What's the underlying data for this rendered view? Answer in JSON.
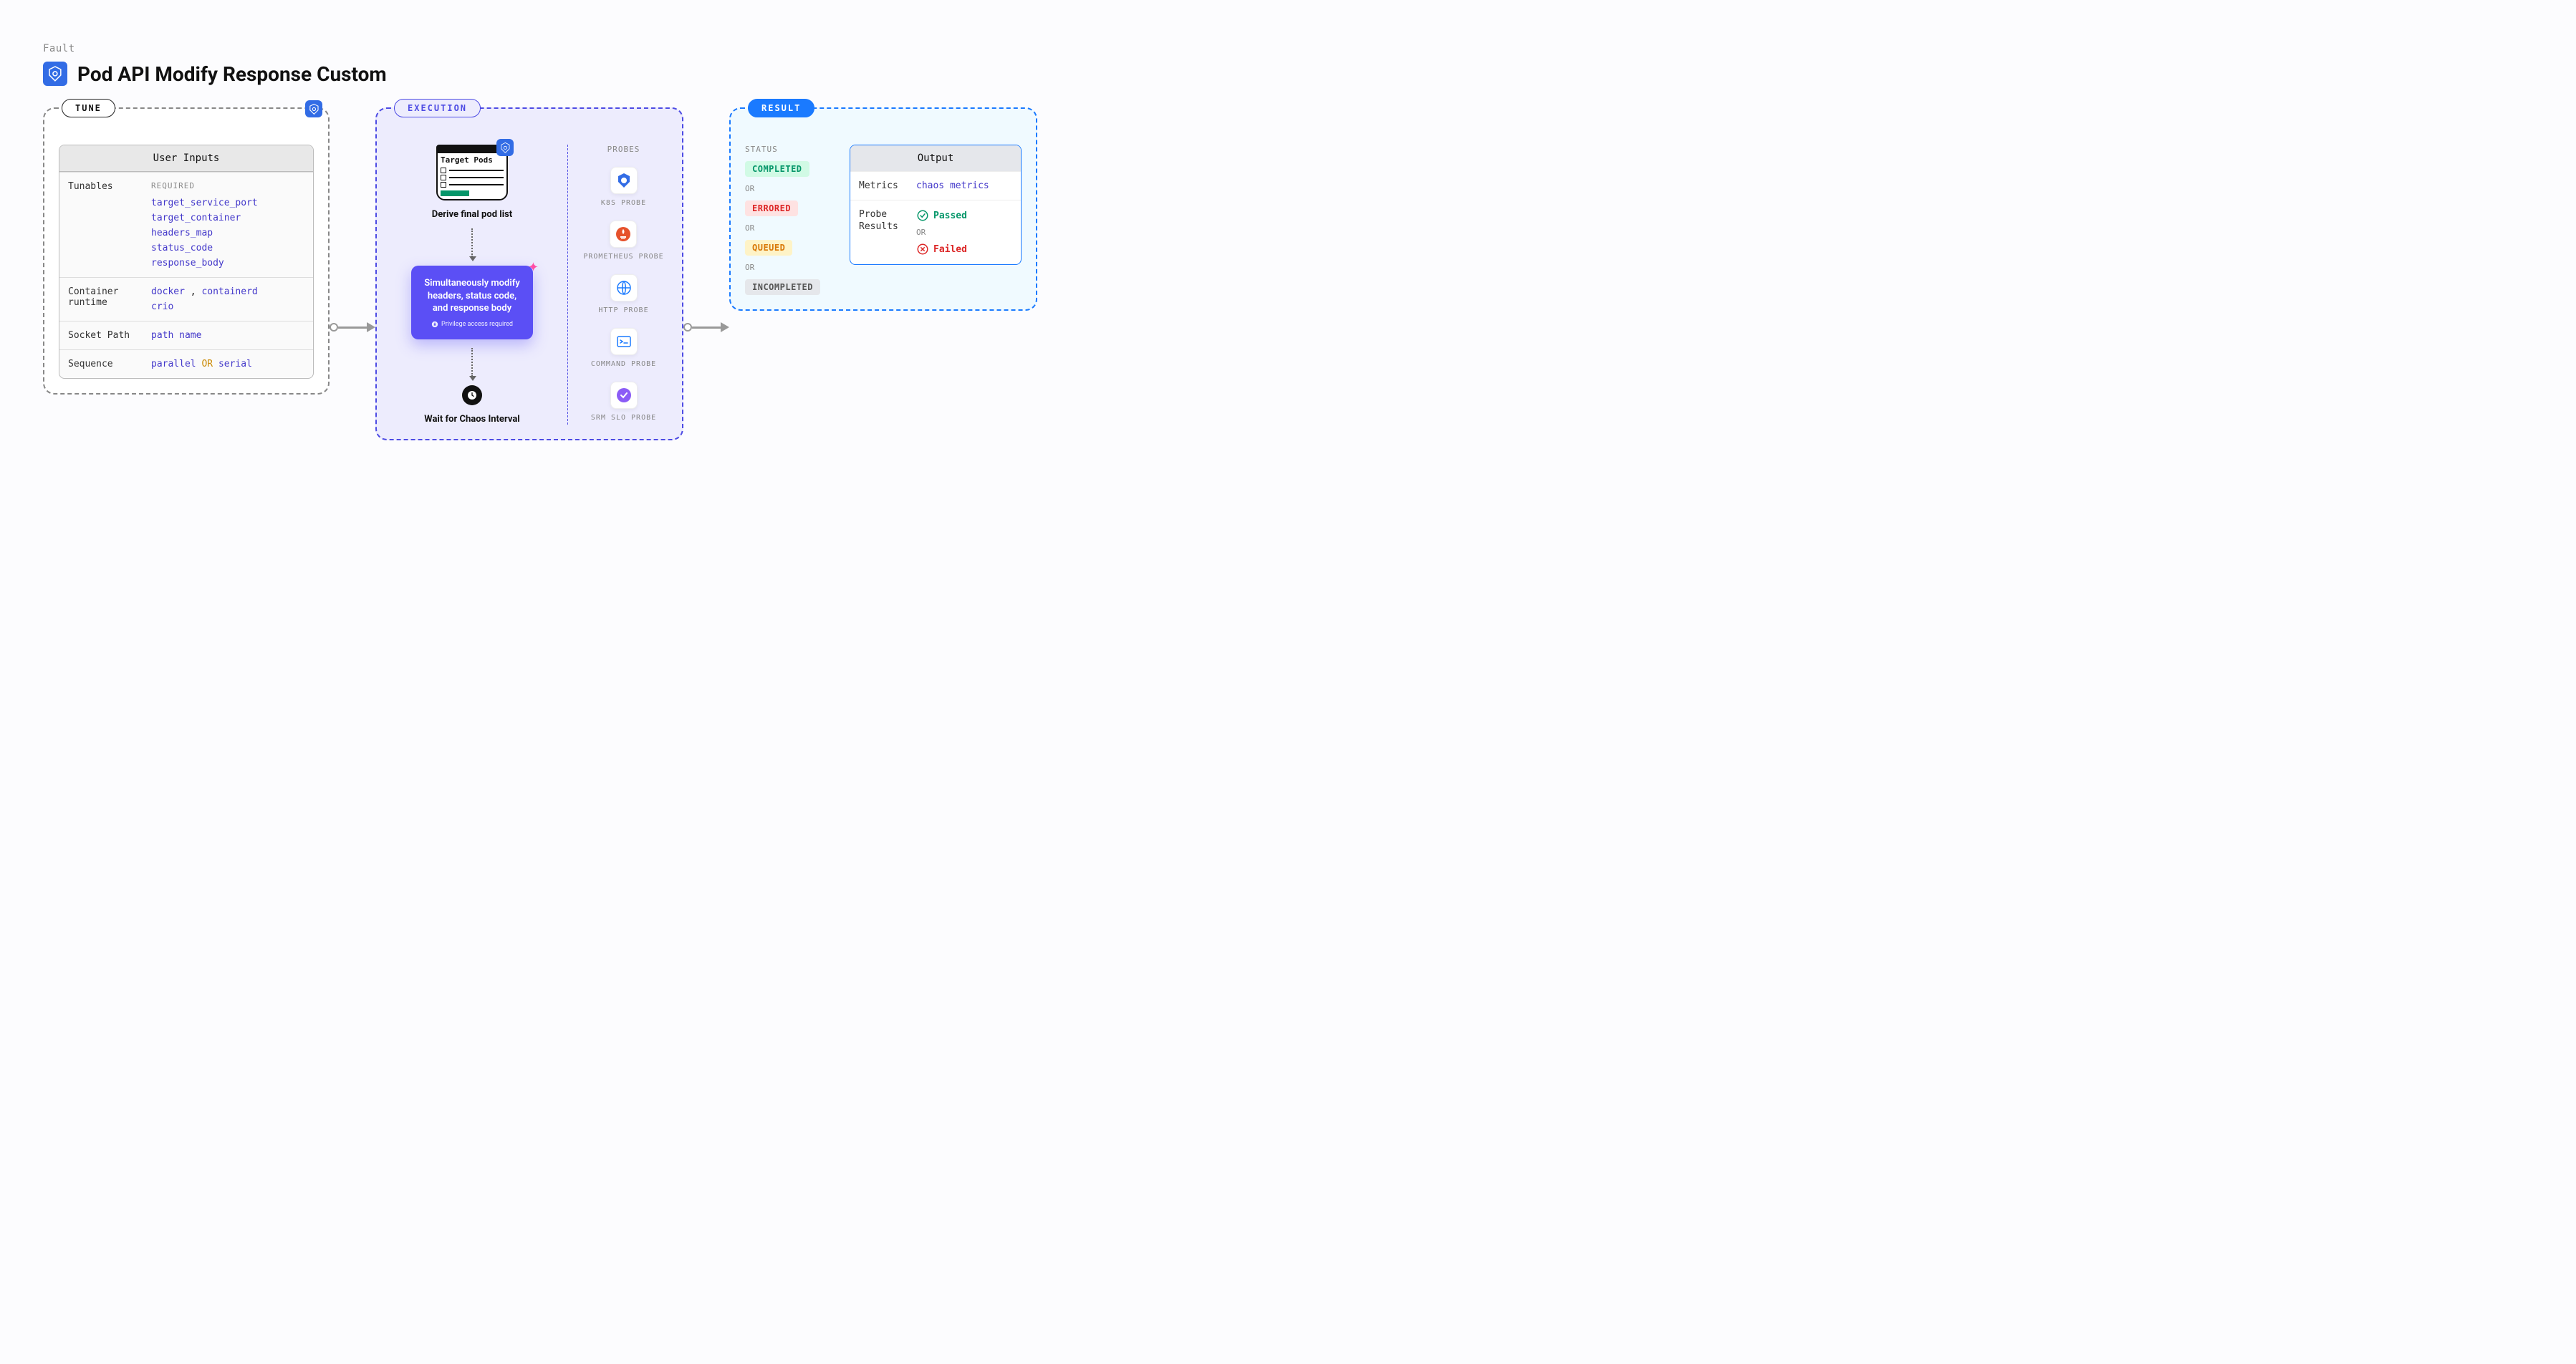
{
  "breadcrumb": "Fault",
  "title": "Pod API Modify Response Custom",
  "phases": {
    "tune": "TUNE",
    "execution": "EXECUTION",
    "result": "RESULT"
  },
  "tune": {
    "box_title": "User Inputs",
    "required_label": "REQUIRED",
    "rows": {
      "tunables": {
        "label": "Tunables",
        "values": [
          "target_service_port",
          "target_container",
          "headers_map",
          "status_code",
          "response_body"
        ]
      },
      "runtime": {
        "label": "Container runtime",
        "values": [
          "docker",
          "containerd",
          "crio"
        ],
        "sep": ","
      },
      "socket": {
        "label": "Socket Path",
        "value": "path name"
      },
      "sequence": {
        "label": "Sequence",
        "v1": "parallel",
        "or": "OR",
        "v2": "serial"
      }
    }
  },
  "execution": {
    "target_pods_card_title": "Target Pods",
    "step1": "Derive final pod list",
    "action_card": "Simultaneously modify headers, status code, and response body",
    "privilege_note": "Privilege access required",
    "step3": "Wait for Chaos Interval",
    "probes_header": "PROBES",
    "probes": [
      {
        "label": "K8S PROBE",
        "icon": "k8s"
      },
      {
        "label": "PROMETHEUS PROBE",
        "icon": "prometheus"
      },
      {
        "label": "HTTP PROBE",
        "icon": "http"
      },
      {
        "label": "COMMAND PROBE",
        "icon": "command"
      },
      {
        "label": "SRM SLO PROBE",
        "icon": "srm"
      }
    ]
  },
  "result": {
    "status_header": "STATUS",
    "or": "OR",
    "statuses": {
      "completed": "COMPLETED",
      "errored": "ERRORED",
      "queued": "QUEUED",
      "incompleted": "INCOMPLETED"
    },
    "output": {
      "title": "Output",
      "metrics_label": "Metrics",
      "metrics_value": "chaos metrics",
      "probe_results_label": "Probe Results",
      "passed": "Passed",
      "failed": "Failed",
      "or": "OR"
    }
  }
}
